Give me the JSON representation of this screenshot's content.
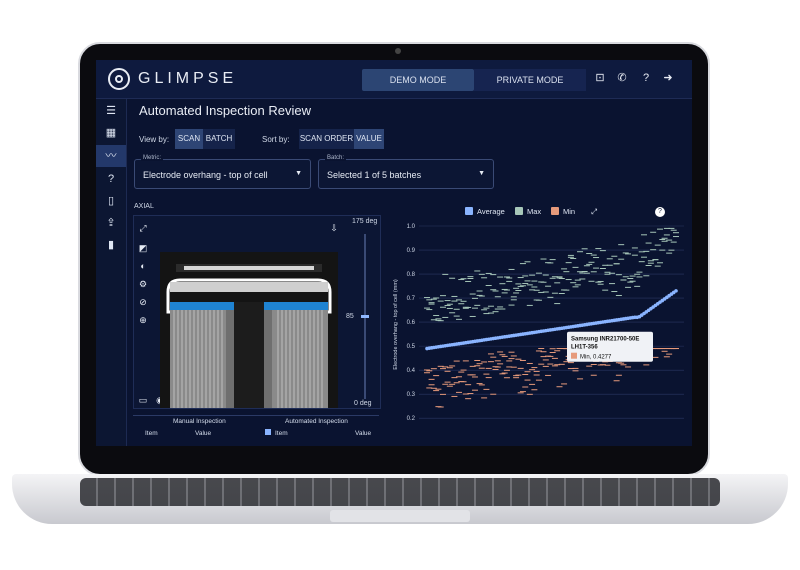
{
  "app": {
    "logo_text": "GLIMPSE",
    "modes": [
      "DEMO MODE",
      "PRIVATE MODE"
    ]
  },
  "page": {
    "title": "Automated Inspection Review",
    "view_by_label": "View by:",
    "view_by_options": [
      "SCAN",
      "BATCH"
    ],
    "sort_by_label": "Sort by:",
    "sort_by_options": [
      "SCAN ORDER",
      "VALUE"
    ]
  },
  "metric": {
    "label": "Metric:",
    "value": "Electrode overhang - top of cell"
  },
  "batch": {
    "label": "Batch:",
    "value": "Selected 1 of 5 batches"
  },
  "viewer": {
    "title": "AXIAL",
    "slider_top": "175 deg",
    "slider_value": "85",
    "slider_bottom": "0 deg",
    "slider_level_fraction": 0.49
  },
  "tables": {
    "manual_title": "Manual Inspection",
    "automated_title": "Automated Inspection",
    "col_item": "Item",
    "col_value": "Value"
  },
  "chart_data": {
    "type": "scatter",
    "ylabel": "Electrode overhang - top of cell (mm)",
    "ylim": [
      0.18,
      1.0
    ],
    "yticks": [
      0.2,
      0.3,
      0.4,
      0.5,
      0.6,
      0.7,
      0.8,
      0.9,
      1.0
    ],
    "legend": [
      {
        "name": "Average",
        "color": "#8ab4ff"
      },
      {
        "name": "Max",
        "color": "#a7c7b9"
      },
      {
        "name": "Min",
        "color": "#e69a7b"
      }
    ],
    "series_average": {
      "start": 0.49,
      "mid": 0.62,
      "end": 0.73
    },
    "series_max_range": [
      0.59,
      0.99
    ],
    "series_min_range": [
      0.21,
      0.49
    ],
    "tooltip": {
      "line1": "Samsung INR21700-50E",
      "line2": "LH1T-356",
      "line3": "Min, 0.4277",
      "value": 0.4277
    }
  },
  "colors": {
    "accent": "#8ab4ff",
    "max": "#a7c7b9",
    "min": "#e69a7b",
    "background": "#0a1330"
  }
}
